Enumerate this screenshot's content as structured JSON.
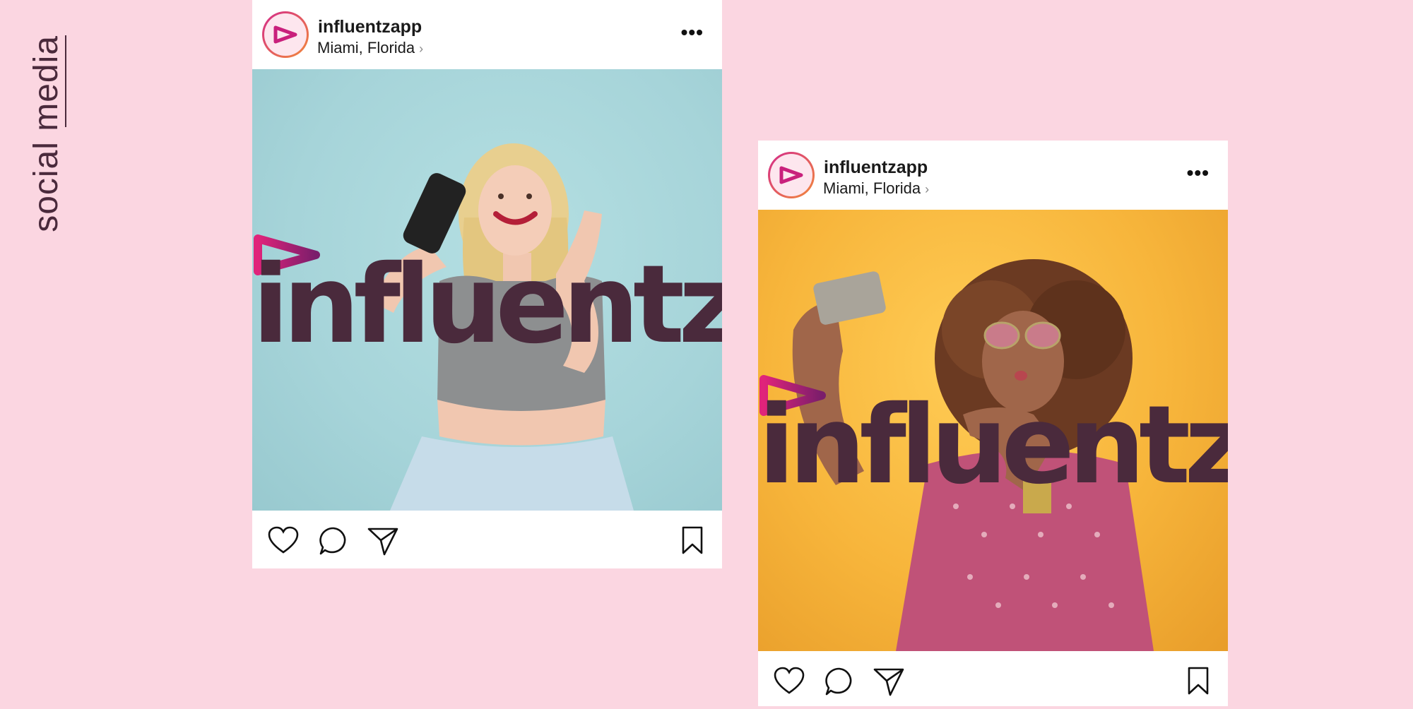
{
  "side_label": "social media",
  "posts": [
    {
      "username": "influentzapp",
      "location": "Miami, Florida",
      "more_label": "•••",
      "logo_text": "influentz"
    },
    {
      "username": "influentzapp",
      "location": "Miami, Florida",
      "more_label": "•••",
      "logo_text": "influentz"
    }
  ],
  "icons": {
    "like": "heart-icon",
    "comment": "comment-icon",
    "share": "send-icon",
    "save": "bookmark-icon",
    "chevron": "chevron-right-icon",
    "more": "more-icon"
  },
  "colors": {
    "background": "#fbd6e1",
    "brand_dark": "#4a2a3c",
    "brand_magenta": "#d4237a",
    "brand_purple": "#7a1e6b",
    "post1_bg": "#a6d4d9",
    "post2_bg": "#f7b53b"
  }
}
